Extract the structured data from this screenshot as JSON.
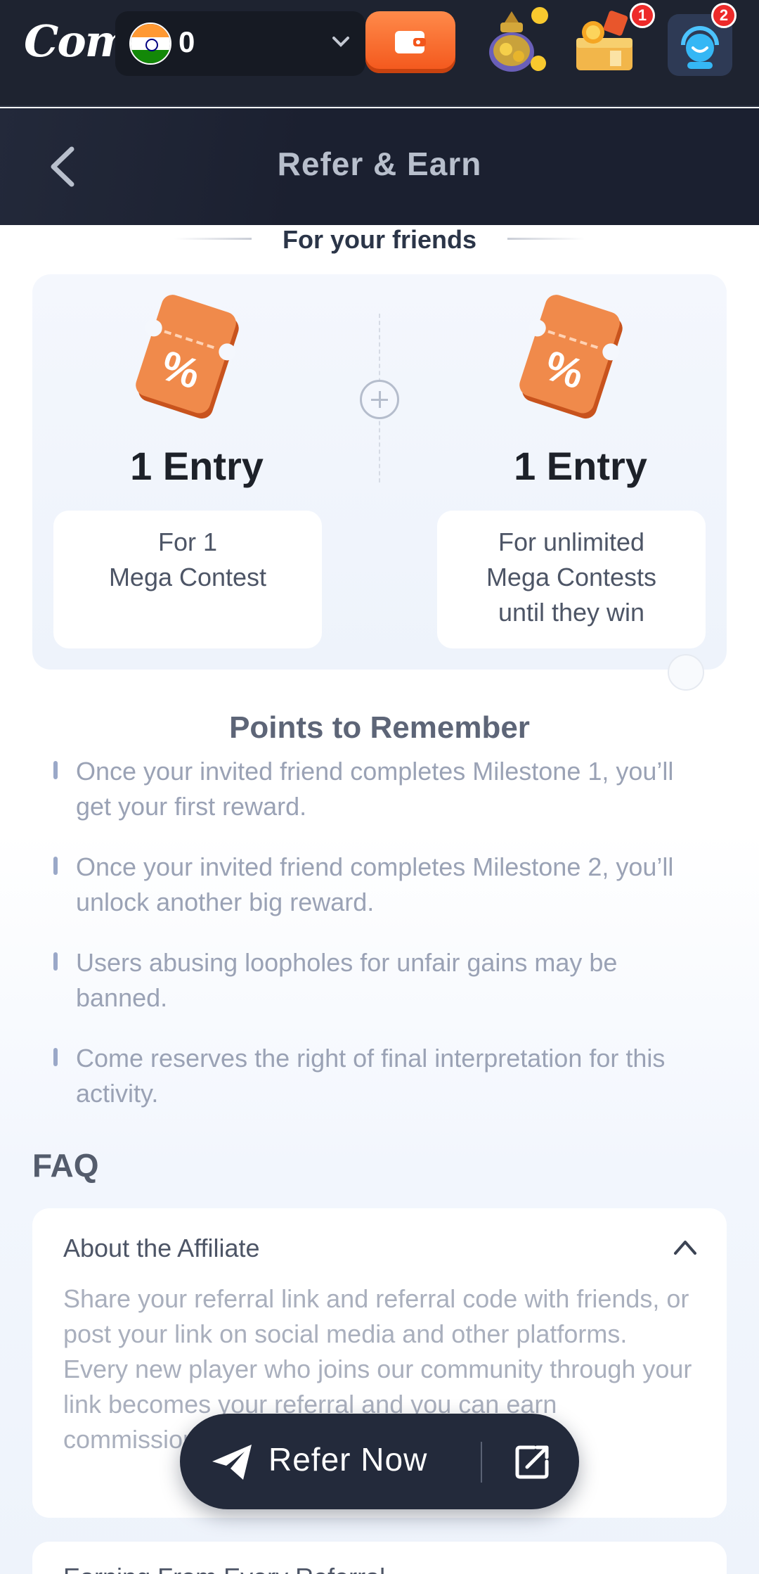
{
  "topbar": {
    "logo_text": "Come",
    "balance": "0",
    "currency_flag": "india-flag-icon",
    "wallet_icon": "wallet-icon",
    "icons": [
      {
        "name": "treasure-pot-icon",
        "badge": ""
      },
      {
        "name": "gift-chest-icon",
        "badge": "1"
      },
      {
        "name": "support-icon",
        "badge": "2"
      }
    ]
  },
  "header": {
    "title": "Refer & Earn",
    "back_icon": "chevron-left-icon"
  },
  "friends": {
    "title": "For your friends",
    "rewards": [
      {
        "entry": "1 Entry",
        "desc_line1": "For 1",
        "desc_line2": "Mega Contest",
        "desc_line3": ""
      },
      {
        "entry": "1 Entry",
        "desc_line1": "For unlimited",
        "desc_line2": "Mega Contests",
        "desc_line3": "until they win"
      }
    ]
  },
  "points": {
    "title": "Points to Remember",
    "items": [
      "Once your invited friend completes Milestone 1, you’ll get your first reward.",
      "Once your invited friend completes Milestone 2, you’ll unlock another big reward.",
      "Users abusing loopholes for unfair gains may be banned.",
      "Come reserves the right of final interpretation for this activity."
    ]
  },
  "faq": {
    "title": "FAQ",
    "items": [
      {
        "question": "About the Affiliate",
        "expanded": true,
        "answer": "Share your referral link and referral code with friends, or post your link on social media and other platforms. Every new player who joins our community through your link becomes your referral and you can earn commissions and rewa"
      },
      {
        "question": "Earning From Every Referral",
        "expanded": false,
        "answer": ""
      }
    ]
  },
  "refer_button": {
    "label": "Refer Now",
    "icon": "paper-plane-icon",
    "share_icon": "share-icon"
  },
  "colors": {
    "topbar_bg": "#1e2330",
    "accent_orange": "#f3561b",
    "badge_red": "#ee2a2a",
    "refer_btn_bg": "#232a3b"
  }
}
